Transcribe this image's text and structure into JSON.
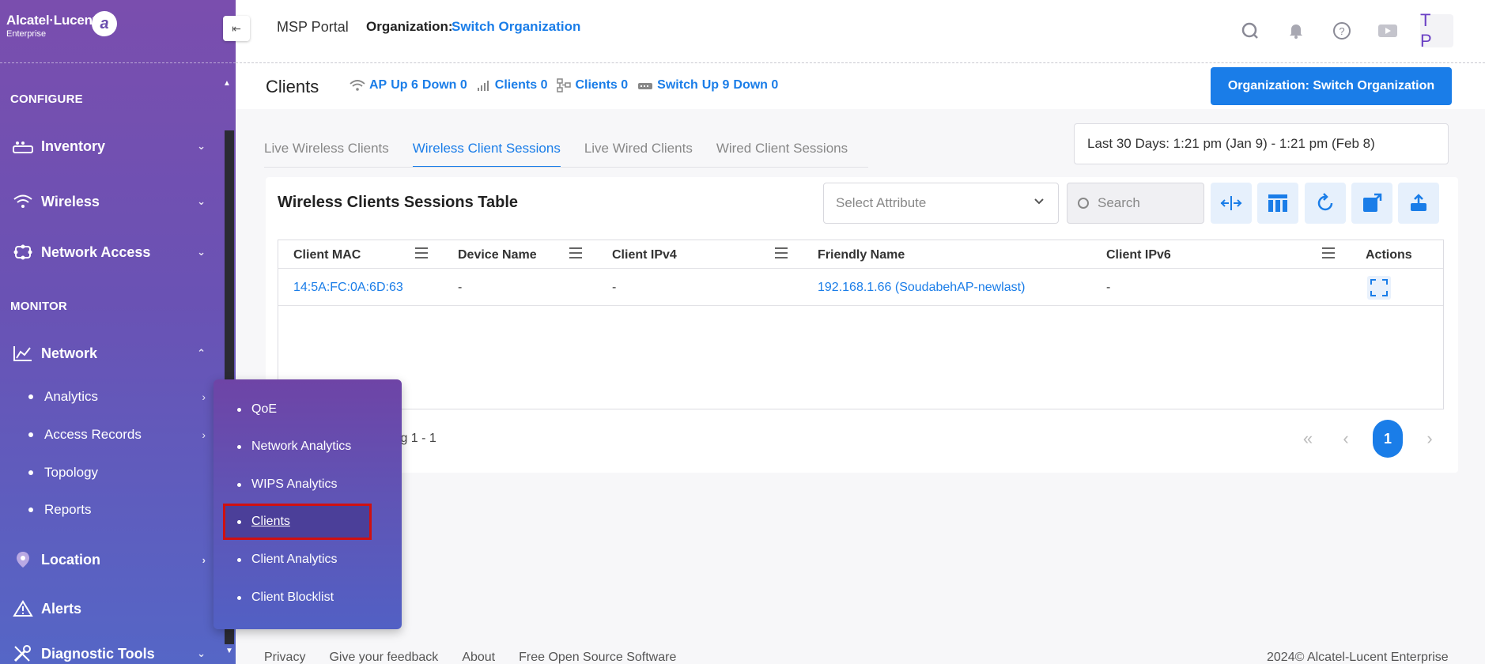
{
  "brand": {
    "name": "Alcatel·Lucent",
    "sub": "Enterprise",
    "mark": "a"
  },
  "sidebar": {
    "configure_label": "CONFIGURE",
    "monitor_label": "MONITOR",
    "items": [
      {
        "label": "Inventory",
        "icon": "inventory-icon"
      },
      {
        "label": "Wireless",
        "icon": "wifi-icon"
      },
      {
        "label": "Network Access",
        "icon": "network-access-icon"
      },
      {
        "label": "Network",
        "icon": "network-chart-icon"
      },
      {
        "label": "Location",
        "icon": "location-pin-icon"
      },
      {
        "label": "Alerts",
        "icon": "alert-triangle-icon"
      },
      {
        "label": "Diagnostic Tools",
        "icon": "tools-icon"
      }
    ],
    "network_sub": [
      "Analytics",
      "Access Records",
      "Topology",
      "Reports"
    ]
  },
  "flyout": [
    "QoE",
    "Network Analytics",
    "WIPS Analytics",
    "Clients",
    "Client Analytics",
    "Client Blocklist"
  ],
  "header": {
    "portal": "MSP Portal",
    "org_label": "Organization:",
    "org_link": "Switch Organization",
    "avatar": "T P"
  },
  "page": {
    "title": "Clients",
    "stats": {
      "ap_label": "AP",
      "ap_up": "Up 6",
      "ap_down": "Down 0",
      "wireless_clients": "Clients 0",
      "wired_clients": "Clients 0",
      "switch_label": "Switch",
      "switch_up": "Up 9",
      "switch_down": "Down 0"
    },
    "org_button": "Organization: Switch Organization"
  },
  "tabs": [
    "Live Wireless Clients",
    "Wireless Client Sessions",
    "Live Wired Clients",
    "Wired Client Sessions"
  ],
  "date_range": "Last 30 Days: 1:21 pm (Jan 9) - 1:21 pm (Feb 8)",
  "card": {
    "title": "Wireless Clients Sessions Table",
    "attr_placeholder": "Select Attribute",
    "search_placeholder": "Search"
  },
  "table": {
    "headers": [
      "Client MAC",
      "Device Name",
      "Client IPv4",
      "Friendly Name",
      "Client IPv6",
      "Actions"
    ],
    "rows": [
      {
        "mac": "14:5A:FC:0A:6D:63",
        "device": "-",
        "ipv4": "-",
        "friendly": "192.168.1.66 (SoudabehAP-newlast)",
        "ipv6": "-"
      }
    ]
  },
  "pagination": {
    "showing": "ing 1 - 1",
    "current": "1"
  },
  "footer": {
    "links": [
      "Privacy",
      "Give your feedback",
      "About",
      "Free Open Source Software"
    ],
    "copyright": "2024© Alcatel-Lucent Enterprise"
  },
  "colors": {
    "accent": "#1a7de8",
    "sidebar_top": "#7a4eae",
    "sidebar_bottom": "#5566c6",
    "highlight": "#d01010"
  }
}
